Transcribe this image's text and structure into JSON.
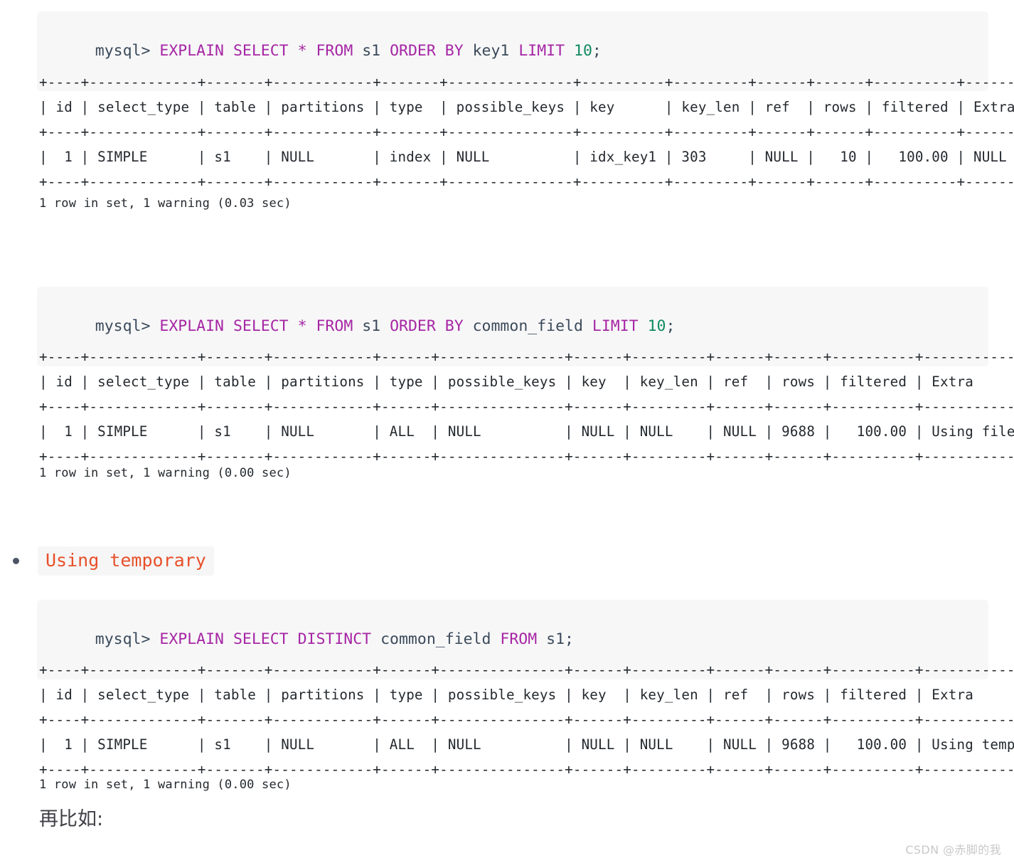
{
  "code_blocks": [
    {
      "name": "explain-order-by-key1",
      "prompt": "mysql> ",
      "tokens": [
        {
          "t": "EXPLAIN",
          "c": "kw"
        },
        {
          "t": " ",
          "c": "sp"
        },
        {
          "t": "SELECT",
          "c": "kw"
        },
        {
          "t": " ",
          "c": "sp"
        },
        {
          "t": "*",
          "c": "op"
        },
        {
          "t": " ",
          "c": "sp"
        },
        {
          "t": "FROM",
          "c": "kw"
        },
        {
          "t": " ",
          "c": "sp"
        },
        {
          "t": "s1",
          "c": "id"
        },
        {
          "t": " ",
          "c": "sp"
        },
        {
          "t": "ORDER",
          "c": "kw"
        },
        {
          "t": " ",
          "c": "sp"
        },
        {
          "t": "BY",
          "c": "kw"
        },
        {
          "t": " ",
          "c": "sp"
        },
        {
          "t": "key1",
          "c": "id"
        },
        {
          "t": " ",
          "c": "sp"
        },
        {
          "t": "LIMIT",
          "c": "kw"
        },
        {
          "t": " ",
          "c": "sp"
        },
        {
          "t": "10",
          "c": "num"
        },
        {
          "t": ";",
          "c": "punc"
        }
      ],
      "plain": "mysql> EXPLAIN SELECT * FROM s1 ORDER BY key1 LIMIT 10;"
    },
    {
      "name": "explain-order-by-common-field",
      "prompt": "mysql> ",
      "tokens": [
        {
          "t": "EXPLAIN",
          "c": "kw"
        },
        {
          "t": " ",
          "c": "sp"
        },
        {
          "t": "SELECT",
          "c": "kw"
        },
        {
          "t": " ",
          "c": "sp"
        },
        {
          "t": "*",
          "c": "op"
        },
        {
          "t": " ",
          "c": "sp"
        },
        {
          "t": "FROM",
          "c": "kw"
        },
        {
          "t": " ",
          "c": "sp"
        },
        {
          "t": "s1",
          "c": "id"
        },
        {
          "t": " ",
          "c": "sp"
        },
        {
          "t": "ORDER",
          "c": "kw"
        },
        {
          "t": " ",
          "c": "sp"
        },
        {
          "t": "BY",
          "c": "kw"
        },
        {
          "t": " ",
          "c": "sp"
        },
        {
          "t": "common_field",
          "c": "id"
        },
        {
          "t": " ",
          "c": "sp"
        },
        {
          "t": "LIMIT",
          "c": "kw"
        },
        {
          "t": " ",
          "c": "sp"
        },
        {
          "t": "10",
          "c": "num"
        },
        {
          "t": ";",
          "c": "punc"
        }
      ],
      "plain": "mysql> EXPLAIN SELECT * FROM s1 ORDER BY common_field LIMIT 10;"
    },
    {
      "name": "explain-select-distinct",
      "prompt": "mysql> ",
      "tokens": [
        {
          "t": "EXPLAIN",
          "c": "kw"
        },
        {
          "t": " ",
          "c": "sp"
        },
        {
          "t": "SELECT",
          "c": "kw"
        },
        {
          "t": " ",
          "c": "sp"
        },
        {
          "t": "DISTINCT",
          "c": "kw"
        },
        {
          "t": " ",
          "c": "sp"
        },
        {
          "t": "common_field",
          "c": "id"
        },
        {
          "t": " ",
          "c": "sp"
        },
        {
          "t": "FROM",
          "c": "kw"
        },
        {
          "t": " ",
          "c": "sp"
        },
        {
          "t": "s1",
          "c": "id"
        },
        {
          "t": ";",
          "c": "punc"
        }
      ],
      "plain": "mysql> EXPLAIN SELECT DISTINCT common_field FROM s1;"
    }
  ],
  "tables": [
    {
      "name": "explain-result-order-by-key1",
      "columns": [
        "id",
        "select_type",
        "table",
        "partitions",
        "type",
        "possible_keys",
        "key",
        "key_len",
        "ref",
        "rows",
        "filtered",
        "Extra"
      ],
      "widths": [
        4,
        13,
        7,
        12,
        7,
        15,
        11,
        9,
        6,
        6,
        10,
        7
      ],
      "aligns": [
        "r",
        "l",
        "l",
        "l",
        "l",
        "l",
        "l",
        "l",
        "l",
        "r",
        "r",
        "l"
      ],
      "rows": [
        [
          "1",
          "SIMPLE",
          "s1",
          "NULL",
          "index",
          "NULL",
          "idx_key1",
          "303",
          "NULL",
          "10",
          "100.00",
          "NULL"
        ]
      ],
      "ascii": "+----+-------------+-------+------------+-------+---------------+----------+---------+------+------+----------+-------+\n| id | select_type | table | partitions | type  | possible_keys | key      | key_len | ref  | rows | filtered | Extra |\n+----+-------------+-------+------------+-------+---------------+----------+---------+------+------+----------+-------+\n|  1 | SIMPLE      | s1    | NULL       | index | NULL          | idx_key1 | 303     | NULL |   10 |   100.00 | NULL  |\n+----+-------------+-------+------------+-------+---------------+----------+---------+------+------+----------+-------+"
    },
    {
      "name": "explain-result-order-by-common-field",
      "columns": [
        "id",
        "select_type",
        "table",
        "partitions",
        "type",
        "possible_keys",
        "key",
        "key_len",
        "ref",
        "rows",
        "filtered",
        "Extra"
      ],
      "widths": [
        4,
        13,
        7,
        12,
        6,
        15,
        6,
        9,
        6,
        6,
        10,
        16
      ],
      "aligns": [
        "r",
        "l",
        "l",
        "l",
        "l",
        "l",
        "l",
        "l",
        "l",
        "r",
        "r",
        "l"
      ],
      "rows": [
        [
          "1",
          "SIMPLE",
          "s1",
          "NULL",
          "ALL",
          "NULL",
          "NULL",
          "NULL",
          "NULL",
          "9688",
          "100.00",
          "Using filesort"
        ]
      ],
      "ascii": "+----+-------------+-------+------------+------+---------------+------+---------+------+------+----------+----------------+\n| id | select_type | table | partitions | type | possible_keys | key  | key_len | ref  | rows | filtered | Extra          |\n+----+-------------+-------+------------+------+---------------+------+---------+------+------+----------+----------------+\n|  1 | SIMPLE      | s1    | NULL       | ALL  | NULL          | NULL | NULL    | NULL | 9688 |   100.00 | Using filesort |\n+----+-------------+-------+------------+------+---------------+------+---------+------+------+----------+----------------+"
    },
    {
      "name": "explain-result-select-distinct",
      "columns": [
        "id",
        "select_type",
        "table",
        "partitions",
        "type",
        "possible_keys",
        "key",
        "key_len",
        "ref",
        "rows",
        "filtered",
        "Extra"
      ],
      "widths": [
        4,
        13,
        7,
        12,
        6,
        15,
        6,
        9,
        6,
        6,
        10,
        17
      ],
      "aligns": [
        "r",
        "l",
        "l",
        "l",
        "l",
        "l",
        "l",
        "l",
        "l",
        "r",
        "r",
        "l"
      ],
      "rows": [
        [
          "1",
          "SIMPLE",
          "s1",
          "NULL",
          "ALL",
          "NULL",
          "NULL",
          "NULL",
          "NULL",
          "9688",
          "100.00",
          "Using temporary"
        ]
      ],
      "ascii": "+----+-------------+-------+------------+------+---------------+------+---------+------+------+----------+-----------------+\n| id | select_type | table | partitions | type | possible_keys | key  | key_len | ref  | rows | filtered | Extra           |\n+----+-------------+-------+------------+------+---------------+------+---------+------+------+----------+-----------------+\n|  1 | SIMPLE      | s1    | NULL       | ALL  | NULL          | NULL | NULL    | NULL | 9688 |   100.00 | Using temporary |\n+----+-------------+-------+------------+------+---------------+------+---------+------+------+----------+-----------------+"
    }
  ],
  "status_lines": [
    "1 row in set, 1 warning (0.03 sec)",
    "1 row in set, 1 warning (0.00 sec)",
    "1 row in set, 1 warning (0.00 sec)"
  ],
  "bullet": {
    "label": "Using temporary",
    "color": "#e8502a"
  },
  "paragraph": "再比如:",
  "watermark": "CSDN @赤脚的我"
}
